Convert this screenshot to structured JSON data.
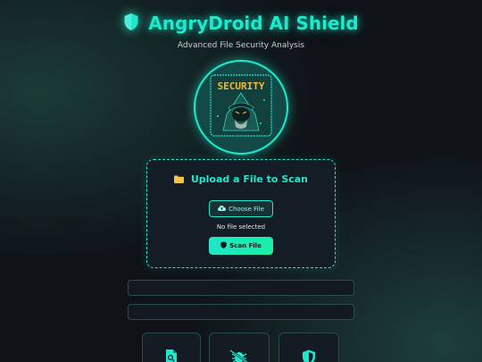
{
  "header": {
    "title": "AngryDroid AI Shield",
    "subtitle": "Advanced File Security Analysis",
    "icon": "shield-icon"
  },
  "logo": {
    "badge_text": "SECURITY",
    "icon": "hooded-hacker-icon"
  },
  "upload": {
    "title": "Upload a File to Scan",
    "title_icon": "folder-icon",
    "choose_label": "Choose File",
    "choose_icon": "cloud-upload-icon",
    "status": "No file selected",
    "scan_label": "Scan File",
    "scan_icon": "shield-icon"
  },
  "features": [
    {
      "icon": "file-search-icon"
    },
    {
      "icon": "bug-slash-icon"
    },
    {
      "icon": "shield-half-icon"
    }
  ],
  "colors": {
    "accent": "#1de9cc",
    "background": "#0f1318",
    "folder": "#f3c34a",
    "scan_button": "#1ee6c8"
  }
}
